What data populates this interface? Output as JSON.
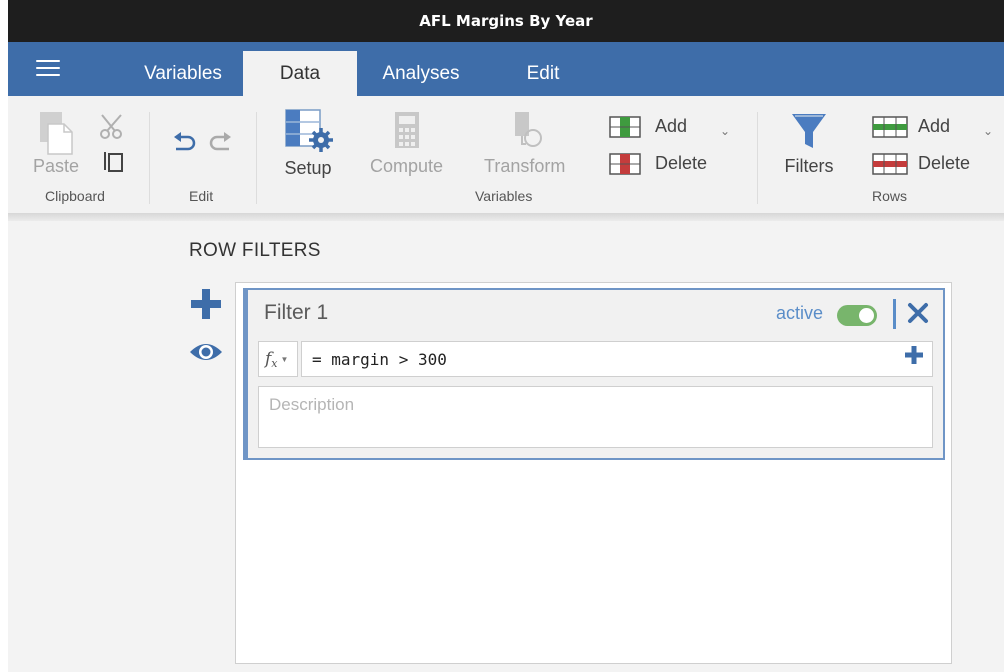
{
  "window": {
    "title": "AFL Margins By Year"
  },
  "tabs": [
    {
      "label": "Variables"
    },
    {
      "label": "Data"
    },
    {
      "label": "Analyses"
    },
    {
      "label": "Edit"
    }
  ],
  "active_tab": "Data",
  "ribbon": {
    "clipboard": {
      "paste_label": "Paste",
      "group_label": "Clipboard"
    },
    "edit": {
      "group_label": "Edit"
    },
    "variables": {
      "setup_label": "Setup",
      "compute_label": "Compute",
      "transform_label": "Transform",
      "add_label": "Add",
      "delete_label": "Delete",
      "group_label": "Variables"
    },
    "rows": {
      "filters_label": "Filters",
      "add_label": "Add",
      "delete_label": "Delete",
      "group_label": "Rows"
    }
  },
  "row_filters": {
    "title": "ROW FILTERS",
    "filters": [
      {
        "name": "Filter 1",
        "status_label": "active",
        "active": true,
        "formula": "= margin > 300",
        "description_placeholder": "Description",
        "description_value": ""
      }
    ]
  },
  "colors": {
    "title_bar": "#1e1e1e",
    "app_bar": "#3e6da9",
    "ribbon": "#f2f2f2",
    "accent": "#5a8dc8",
    "toggle_on": "#78b56c",
    "add_green": "#3f9b3f",
    "delete_red": "#c43c3c"
  }
}
